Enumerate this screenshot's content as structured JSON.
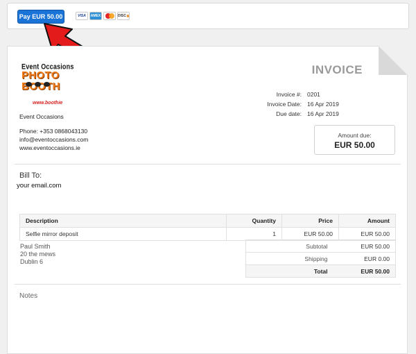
{
  "paybar": {
    "pay_label": "Pay EUR 50.00",
    "cards": [
      {
        "name": "visa",
        "label": "VISA"
      },
      {
        "name": "amex",
        "label": "AMEX"
      },
      {
        "name": "mastercard",
        "label": ""
      },
      {
        "name": "discover",
        "label": "DISC"
      }
    ]
  },
  "logo": {
    "line1": "Event Occasions",
    "line2": "PHOTO BOOTH",
    "line3": "www.boothie"
  },
  "invoice": {
    "title": "INVOICE",
    "meta": [
      {
        "label": "Invoice #:",
        "value": "0201"
      },
      {
        "label": "Invoice Date:",
        "value": "16 Apr 2019"
      },
      {
        "label": "Due date:",
        "value": "16 Apr 2019"
      }
    ],
    "company": "Event Occasions",
    "contact": [
      "Phone: +353 0868043130",
      "info@eventoccasions.com",
      "www.eventoccasions.ie"
    ],
    "amount_due_label": "Amount due:",
    "amount_due_value": "EUR 50.00",
    "bill_to_label": "Bill To:",
    "bill_to_email": "your email.com",
    "columns": [
      "Description",
      "Quantity",
      "Price",
      "Amount"
    ],
    "items": [
      {
        "description": "Selfie mirror deposit",
        "quantity": "1",
        "price": "EUR 50.00",
        "amount": "EUR 50.00"
      }
    ],
    "address": [
      "Paul Smith",
      "20 the mews",
      "Dublin 6"
    ],
    "totals": [
      {
        "label": "Subtotal",
        "value": "EUR 50.00"
      },
      {
        "label": "Shipping",
        "value": "EUR 0.00"
      },
      {
        "label": "Total",
        "value": "EUR 50.00"
      }
    ],
    "notes_label": "Notes"
  },
  "colors": {
    "accent": "#1a73d6",
    "arrow": "#e41b1b",
    "title": "#9a9a9a"
  }
}
